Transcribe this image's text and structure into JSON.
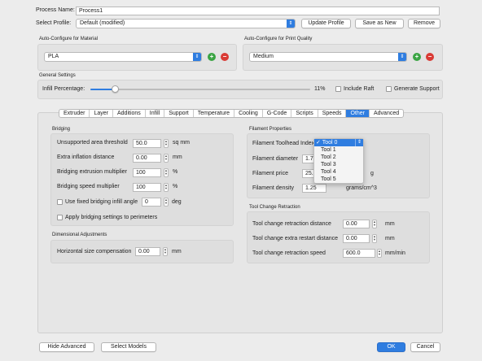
{
  "header": {
    "process_name_label": "Process Name:",
    "process_name_value": "Process1",
    "select_profile_label": "Select Profile:",
    "select_profile_value": "Default (modified)",
    "update_profile": "Update Profile",
    "save_as_new": "Save as New",
    "remove": "Remove"
  },
  "autoconfig_material": {
    "title": "Auto-Configure for Material",
    "value": "PLA"
  },
  "autoconfig_quality": {
    "title": "Auto-Configure for Print Quality",
    "value": "Medium"
  },
  "general": {
    "title": "General Settings",
    "infill_label": "Infill Percentage:",
    "infill_value_text": "11%",
    "infill_fraction": 0.11,
    "include_raft": "Include Raft",
    "generate_support": "Generate Support"
  },
  "tabs": [
    "Extruder",
    "Layer",
    "Additions",
    "Infill",
    "Support",
    "Temperature",
    "Cooling",
    "G-Code",
    "Scripts",
    "Speeds",
    "Other",
    "Advanced"
  ],
  "active_tab": "Other",
  "bridging": {
    "title": "Bridging",
    "unsupported_label": "Unsupported area threshold",
    "unsupported_value": "50.0",
    "unsupported_unit": "sq mm",
    "extra_inflation_label": "Extra inflation distance",
    "extra_inflation_value": "0.00",
    "extra_inflation_unit": "mm",
    "extrusion_mult_label": "Bridging extrusion multiplier",
    "extrusion_mult_value": "100",
    "extrusion_mult_unit": "%",
    "speed_mult_label": "Bridging speed multiplier",
    "speed_mult_value": "100",
    "speed_mult_unit": "%",
    "fixed_angle_label": "Use fixed bridging infill angle",
    "fixed_angle_value": "0",
    "fixed_angle_unit": "deg",
    "apply_perimeters_label": "Apply bridging settings to perimeters"
  },
  "dimensional": {
    "title": "Dimensional Adjustments",
    "horiz_label": "Horizontal size compensation",
    "horiz_value": "0.00",
    "horiz_unit": "mm"
  },
  "filament": {
    "title": "Filament Properties",
    "toolhead_label": "Filament Toolhead Index",
    "diameter_label": "Filament diameter",
    "diameter_value": "1.75",
    "price_label": "Filament price",
    "price_value": "25.0",
    "price_unit": "g",
    "density_label": "Filament density",
    "density_value": "1.25",
    "density_unit": "grams/cm^3"
  },
  "toolhead_menu": {
    "selected": "Tool 0",
    "check": "✓",
    "options": [
      "Tool 1",
      "Tool 2",
      "Tool 3",
      "Tool 4",
      "Tool 5"
    ]
  },
  "toolchange": {
    "title": "Tool Change Retraction",
    "retract_dist_label": "Tool change retraction distance",
    "retract_dist_value": "0.00",
    "retract_dist_unit": "mm",
    "extra_restart_label": "Tool change extra restart distance",
    "extra_restart_value": "0.00",
    "extra_restart_unit": "mm",
    "retract_speed_label": "Tool change retraction speed",
    "retract_speed_value": "600.0",
    "retract_speed_unit": "mm/min"
  },
  "footer": {
    "hide_advanced": "Hide Advanced",
    "select_models": "Select Models",
    "ok": "OK",
    "cancel": "Cancel"
  }
}
